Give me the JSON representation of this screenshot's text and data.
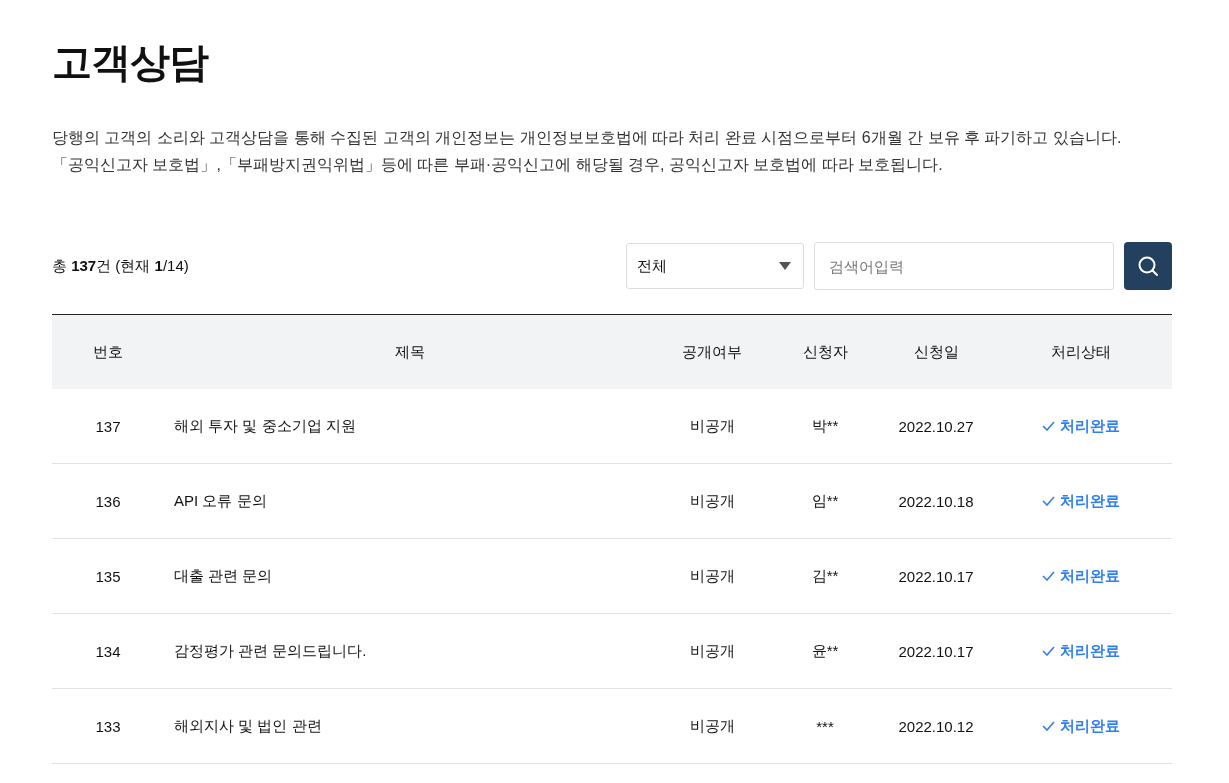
{
  "page": {
    "title": "고객상담",
    "description": [
      "당행의 고객의 소리와 고객상담을 통해 수집된 고객의 개인정보는 개인정보보호법에 따라 처리 완료 시점으로부터 6개월 간 보유 후 파기하고 있습니다.",
      "「공익신고자 보호법」,「부패방지권익위법」등에 따른 부패·공익신고에 해당될 경우, 공익신고자 보호법에 따라 보호됩니다."
    ]
  },
  "toolbar": {
    "count": "총 **137**건 (현재 **1**/14)",
    "filter": {
      "value": "전체"
    },
    "search": {
      "placeholder": "검색어입력"
    }
  },
  "table": {
    "columns": [
      "번호",
      "제목",
      "공개여부",
      "신청자",
      "신청일",
      "처리상태"
    ],
    "rows": [
      {
        "number": "137",
        "title": "해외 투자 및 중소기업 지원",
        "visibility": "비공개",
        "applicant": "박**",
        "date": "2022.10.27",
        "status": {
          "kind": "done",
          "label": "처리완료"
        }
      },
      {
        "number": "136",
        "title": "API 오류 문의",
        "visibility": "비공개",
        "applicant": "임**",
        "date": "2022.10.18",
        "status": {
          "kind": "done",
          "label": "처리완료"
        }
      },
      {
        "number": "135",
        "title": "대출 관련 문의",
        "visibility": "비공개",
        "applicant": "김**",
        "date": "2022.10.17",
        "status": {
          "kind": "done",
          "label": "처리완료"
        }
      },
      {
        "number": "134",
        "title": "감정평가 관련 문의드립니다.",
        "visibility": "비공개",
        "applicant": "윤**",
        "date": "2022.10.17",
        "status": {
          "kind": "done",
          "label": "처리완료"
        }
      },
      {
        "number": "133",
        "title": "해외지사 및 법인 관련",
        "visibility": "비공개",
        "applicant": "***",
        "date": "2022.10.12",
        "status": {
          "kind": "done",
          "label": "처리완료"
        }
      }
    ]
  }
}
